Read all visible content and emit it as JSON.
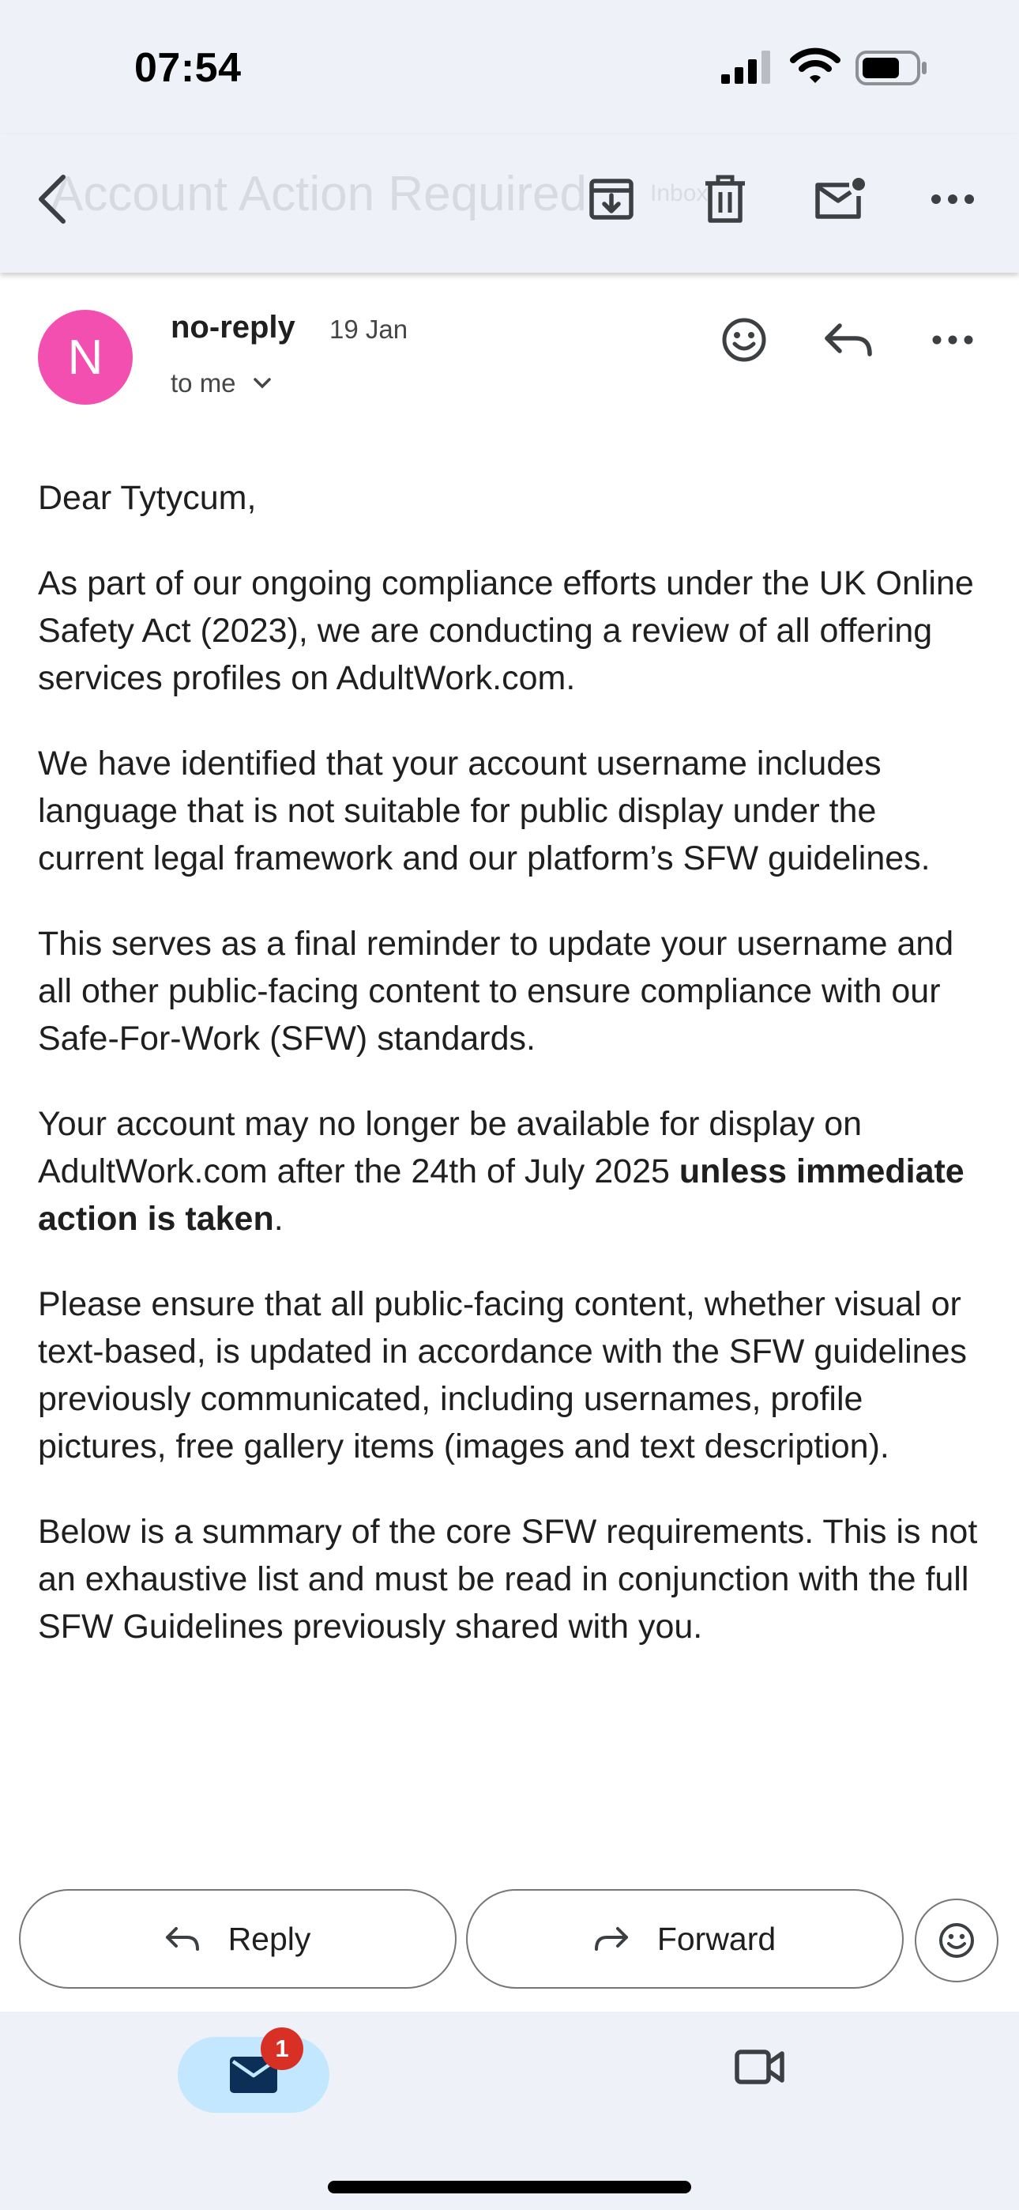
{
  "status_bar": {
    "time": "07:54"
  },
  "toolbar": {
    "subject": "Account Action Required",
    "label": "Inbox"
  },
  "email": {
    "sender_initial": "N",
    "sender_name": "no-reply",
    "date": "19 Jan",
    "recipient": "to me",
    "paragraphs": [
      "Dear Tytycum,",
      "As part of our ongoing compliance efforts under the UK Online Safety Act (2023), we are conducting a review of all offering services profiles on AdultWork.com.",
      "We have identified that your account username includes language that is not suitable for public display under the current legal framework and our platform’s SFW guidelines.",
      "This serves as a final reminder to update your username and all other public-facing content to ensure compliance with our Safe-For-Work (SFW) standards."
    ],
    "p5_before": "Your account may no longer be available for display on AdultWork.com after the 24th of July 2025 ",
    "p5_bold": "unless immediate action is taken",
    "p5_after": ".",
    "paragraphs_after": [
      "Please ensure that all public-facing content, whether visual or text-based, is updated in accordance with the SFW guidelines previously communicated, including usernames, profile pictures, free gallery items (images and text description).",
      "Below is a summary of the core SFW requirements. This is not an exhaustive list and must be read in conjunction with the full SFW Guidelines previously shared with you."
    ]
  },
  "actions": {
    "reply": "Reply",
    "forward": "Forward"
  },
  "nav": {
    "mail_badge": "1"
  },
  "colors": {
    "avatar": "#f24fb0",
    "badge": "#d93025",
    "nav_active": "#c2e7ff",
    "chrome_bg": "#eef1f7"
  },
  "icons": [
    "back-icon",
    "archive-icon",
    "delete-icon",
    "mark-unread-icon",
    "more-icon",
    "emoji-icon",
    "reply-icon",
    "forward-icon",
    "mail-icon",
    "video-icon"
  ]
}
